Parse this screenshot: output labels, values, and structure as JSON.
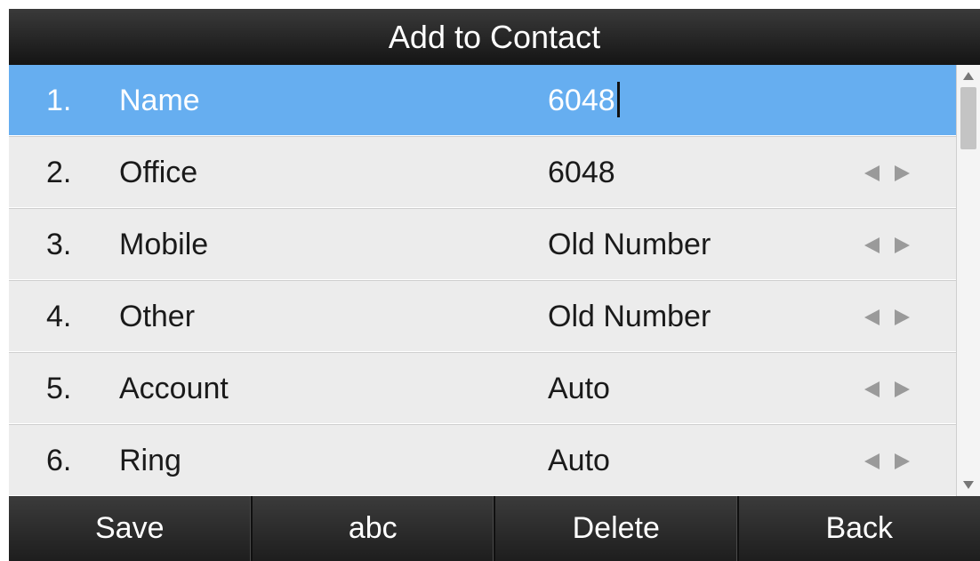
{
  "title": "Add to Contact",
  "rows": [
    {
      "num": "1.",
      "label": "Name",
      "value": "6048",
      "selected": true,
      "has_arrows": false
    },
    {
      "num": "2.",
      "label": "Office",
      "value": "6048",
      "selected": false,
      "has_arrows": true
    },
    {
      "num": "3.",
      "label": "Mobile",
      "value": "Old Number",
      "selected": false,
      "has_arrows": true
    },
    {
      "num": "4.",
      "label": "Other",
      "value": "Old Number",
      "selected": false,
      "has_arrows": true
    },
    {
      "num": "5.",
      "label": "Account",
      "value": "Auto",
      "selected": false,
      "has_arrows": true
    },
    {
      "num": "6.",
      "label": "Ring",
      "value": "Auto",
      "selected": false,
      "has_arrows": true
    }
  ],
  "softkeys": {
    "save": "Save",
    "abc": "abc",
    "delete": "Delete",
    "back": "Back"
  },
  "colors": {
    "selected_row": "#66aef0",
    "row_bg": "#ececec",
    "title_bar": "#1a1a1a"
  },
  "icons": {
    "left_arrow": "triangle-left",
    "right_arrow": "triangle-right",
    "scroll_up": "triangle-up",
    "scroll_down": "triangle-down"
  }
}
